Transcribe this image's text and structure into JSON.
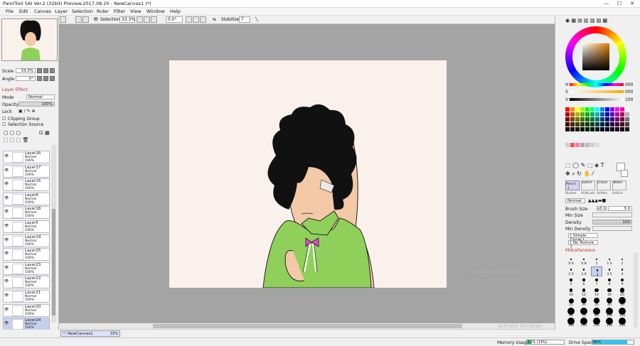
{
  "window": {
    "title": "PaintTool SAI Ver.2 (32bit) Preview.2017.08.20 - NewCanvas1 (*)",
    "minimize": "—",
    "maximize": "☐",
    "close": "✕"
  },
  "menu": [
    "File",
    "Edit",
    "Canvas",
    "Layer",
    "Selection",
    "Ruler",
    "Filter",
    "View",
    "Window",
    "Help"
  ],
  "toolbar": {
    "selection_label": "Selection",
    "zoom": "33.3%",
    "angle": "0.0°",
    "stabilizer_label": "Stabilizer",
    "stabilizer_value": "7"
  },
  "navigator": {
    "scale_label": "Scale",
    "scale_value": "33.3%",
    "angle_label": "Angle",
    "angle_value": "0°"
  },
  "layer_effect": {
    "header": "Layer Effect",
    "mode_label": "Mode",
    "mode_value": "Normal",
    "opacity_label": "Opacity",
    "opacity_value": "100%",
    "lock_label": "Lock",
    "clipping_group": "Clipping Group",
    "selection_source": "Selection Source"
  },
  "layers": [
    {
      "name": "Layer16",
      "mode": "Normal",
      "opacity": "100%"
    },
    {
      "name": "Layer17",
      "mode": "Normal",
      "opacity": "100%"
    },
    {
      "name": "Layer15",
      "mode": "Normal",
      "opacity": "100%"
    },
    {
      "name": "Layer6",
      "mode": "Normal",
      "opacity": "100%"
    },
    {
      "name": "Layer18",
      "mode": "Normal",
      "opacity": "100%"
    },
    {
      "name": "Layer5",
      "mode": "Normal",
      "opacity": "100%"
    },
    {
      "name": "Layer19",
      "mode": "Normal",
      "opacity": "100%"
    },
    {
      "name": "Layer25",
      "mode": "Normal",
      "opacity": "100%"
    },
    {
      "name": "Layer23",
      "mode": "Normal",
      "opacity": "100%"
    },
    {
      "name": "Layer22",
      "mode": "Normal",
      "opacity": "100%"
    },
    {
      "name": "Layer21",
      "mode": "Normal",
      "opacity": "100%"
    },
    {
      "name": "Layer20",
      "mode": "Normal",
      "opacity": "100%"
    },
    {
      "name": "Layer24",
      "mode": "Normal",
      "opacity": "100%"
    }
  ],
  "color": {
    "h_label": "H",
    "h_value": "000",
    "s_label": "S",
    "s_value": "000",
    "v_label": "V",
    "v_value": "100"
  },
  "tools": {
    "pencil": "Pencil",
    "sketch": "sketch",
    "eraser": "Eraser",
    "water": "Water",
    "pencil_size": "1",
    "row2": [
      "Bucket",
      "AirBrush",
      "SelPen",
      "SelEra"
    ]
  },
  "brush": {
    "blend_mode": "Normal",
    "size_label": "Brush Size",
    "size_multiplier": "x0.1",
    "size_value": "3.0",
    "min_size_label": "Min Size",
    "density_label": "Density",
    "density_value": "100",
    "min_density_label": "Min Density",
    "shape": "[ Simple Circle ]",
    "texture": "[ No Texture ]",
    "misc_label": "Miscellaneous"
  },
  "brush_sizes": [
    "0.6",
    "0.8",
    "1",
    "1.5",
    "2",
    "2.3",
    "2.6",
    "3",
    "3.5",
    "4",
    "5",
    "6",
    "7",
    "8",
    "9",
    "10",
    "12",
    "14",
    "16",
    "20",
    "25",
    "30",
    "35",
    "40",
    "50",
    "60",
    "70",
    "80",
    "100",
    "120",
    "160",
    "200",
    "250",
    "300",
    "350"
  ],
  "canvas_tab": {
    "name": "NewCanvas1",
    "zoom": "33%"
  },
  "status": {
    "memory_label": "Memory Usage",
    "memory_value": "12% (14%)",
    "drive_label": "Drive Space",
    "drive_value": "85%",
    "memory_fraction": 0.12,
    "drive_fraction": 0.85
  },
  "watermark": "Activate Windows",
  "watermark_sub": "Go to Settings to activate Windows."
}
